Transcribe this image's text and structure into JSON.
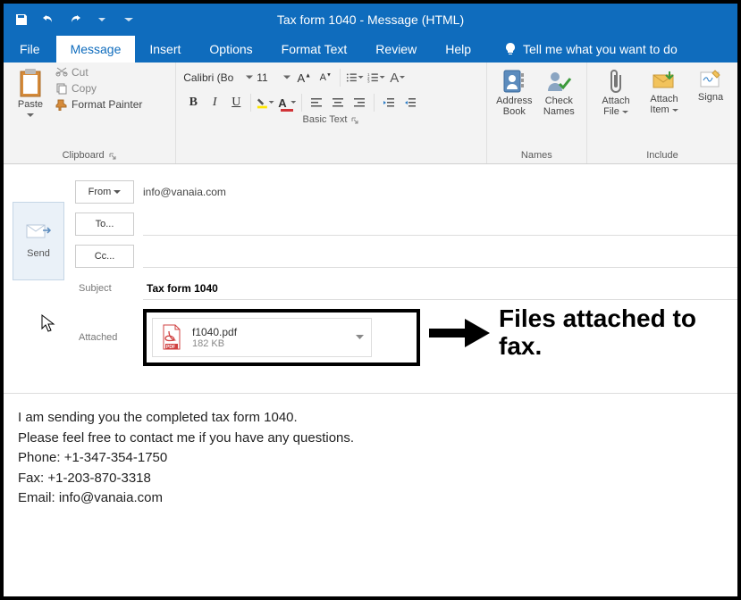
{
  "window": {
    "title": "Tax form 1040  -  Message (HTML)"
  },
  "qat": {
    "save": "save-icon",
    "undo": "undo-icon",
    "redo": "redo-icon"
  },
  "tabs": {
    "file": "File",
    "message": "Message",
    "insert": "Insert",
    "options": "Options",
    "formattext": "Format Text",
    "review": "Review",
    "help": "Help",
    "tellme": "Tell me what you want to do"
  },
  "ribbon": {
    "clipboard": {
      "paste": "Paste",
      "cut": "Cut",
      "copy": "Copy",
      "formatpainter": "Format Painter",
      "label": "Clipboard"
    },
    "basictext": {
      "fontname": "Calibri (Bo",
      "fontsize": "11",
      "bold": "B",
      "italic": "I",
      "underline": "U",
      "label": "Basic Text"
    },
    "names": {
      "addressbook": "Address Book",
      "checknames": "Check Names",
      "label": "Names"
    },
    "include": {
      "attachfile": "Attach File",
      "attachitem": "Attach Item",
      "signature": "Signa",
      "label": "Include"
    }
  },
  "compose": {
    "send": "Send",
    "fromlabel": "From",
    "fromvalue": "info@vanaia.com",
    "to": "To...",
    "cc": "Cc...",
    "subjectlabel": "Subject",
    "subject": "Tax form 1040",
    "attachedlabel": "Attached",
    "attachment": {
      "name": "f1040.pdf",
      "size": "182 KB"
    }
  },
  "body": {
    "line1": "I am sending you the completed tax form 1040.",
    "line2": "Please feel free to contact me if you have any questions.",
    "line3": "Phone: +1-347-354-1750",
    "line4": "Fax: +1-203-870-3318",
    "line5": "Email: info@vanaia.com"
  },
  "annotation": "Files attached to fax."
}
